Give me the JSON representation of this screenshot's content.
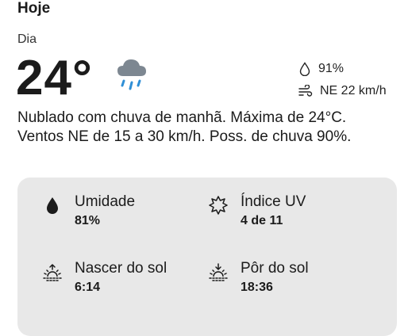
{
  "header": {
    "title": "Hoje"
  },
  "current": {
    "period": "Dia",
    "temperature": "24°",
    "condition_icon": "cloud-rain-icon",
    "precip_chance": "91%",
    "wind": "NE 22 km/h"
  },
  "description": "Nublado com chuva de manhã. Máxima de 24°C. Ventos NE de 15 a 30 km/h. Poss. de chuva 90%.",
  "details": {
    "humidity": {
      "label": "Umidade",
      "value": "81%",
      "icon": "droplet-icon"
    },
    "uv": {
      "label": "Índice UV",
      "value": "4 de 11",
      "icon": "sun-uv-icon"
    },
    "sunrise": {
      "label": "Nascer do sol",
      "value": "6:14",
      "icon": "sunrise-icon"
    },
    "sunset": {
      "label": "Pôr do sol",
      "value": "18:36",
      "icon": "sunset-icon"
    }
  },
  "colors": {
    "card_bg": "#e8e8e8",
    "rain_drops": "#2f8fd6",
    "cloud": "#7d8791"
  }
}
